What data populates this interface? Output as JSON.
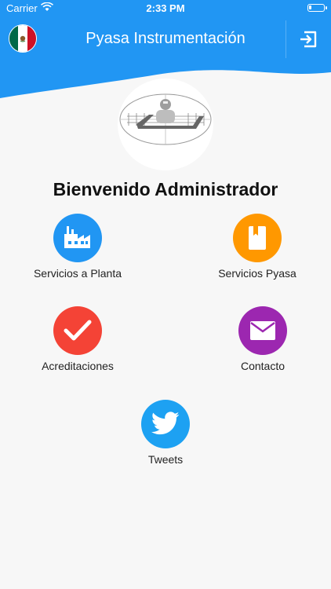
{
  "status_bar": {
    "carrier": "Carrier",
    "time": "2:33 PM"
  },
  "header": {
    "title": "Pyasa Instrumentación"
  },
  "welcome": "Bienvenido Administrador",
  "menu": [
    {
      "label": "Servicios a Planta",
      "icon": "factory-icon",
      "color": "#2196f3"
    },
    {
      "label": "Servicios Pyasa",
      "icon": "book-icon",
      "color": "#ff9800"
    },
    {
      "label": "Acreditaciones",
      "icon": "check-icon",
      "color": "#f44336"
    },
    {
      "label": "Contacto",
      "icon": "mail-icon",
      "color": "#9c27b0"
    },
    {
      "label": "Tweets",
      "icon": "twitter-icon",
      "color": "#1da1f2"
    }
  ],
  "colors": {
    "header": "#2196f3",
    "background": "#f7f7f7"
  }
}
